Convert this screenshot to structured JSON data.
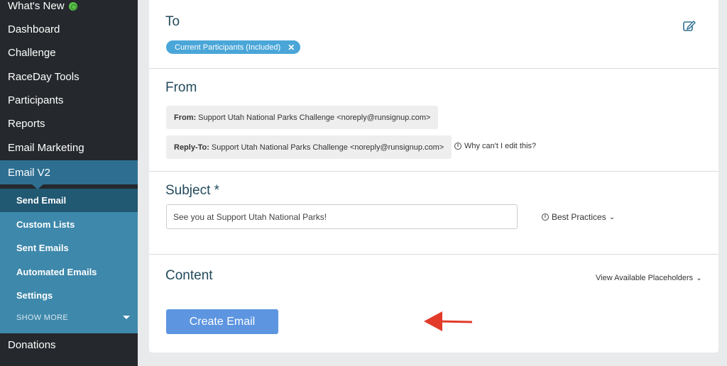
{
  "sidebar": {
    "items": [
      {
        "label": "What's New"
      },
      {
        "label": "Dashboard"
      },
      {
        "label": "Challenge"
      },
      {
        "label": "RaceDay Tools"
      },
      {
        "label": "Participants"
      },
      {
        "label": "Reports"
      },
      {
        "label": "Email Marketing"
      }
    ],
    "active": {
      "label": "Email V2"
    },
    "sub_items": [
      {
        "label": "Send Email",
        "selected": true
      },
      {
        "label": "Custom Lists"
      },
      {
        "label": "Sent Emails"
      },
      {
        "label": "Automated Emails"
      },
      {
        "label": "Settings"
      }
    ],
    "show_more": "SHOW  MORE",
    "after_items": [
      {
        "label": "Donations"
      }
    ],
    "colors": {
      "bg": "#25282c",
      "active": "#2e6f91",
      "sub_bg": "#3e88ab",
      "sub_selected": "#215872",
      "badge": "#59c04a"
    }
  },
  "to": {
    "heading": "To",
    "tag_label": "Current Participants (Included)",
    "tag_remove": "✕"
  },
  "from": {
    "heading": "From",
    "from_label": "From:",
    "from_value": "Support Utah National Parks Challenge <noreply@runsignup.com>",
    "reply_label": "Reply-To:",
    "reply_value": "Support Utah National Parks Challenge <noreply@runsignup.com>",
    "why_link": "Why can't I edit this?"
  },
  "subject": {
    "heading": "Subject *",
    "value": "See you at Support Utah National Parks!",
    "best_practices": "Best Practices"
  },
  "content": {
    "heading": "Content",
    "placeholders_link": "View Available Placeholders",
    "create_button": "Create Email"
  },
  "colors": {
    "heading": "#234a5c",
    "button": "#5d95e0",
    "tag": "#4aa6d8",
    "arrow": "#e23b2a"
  }
}
